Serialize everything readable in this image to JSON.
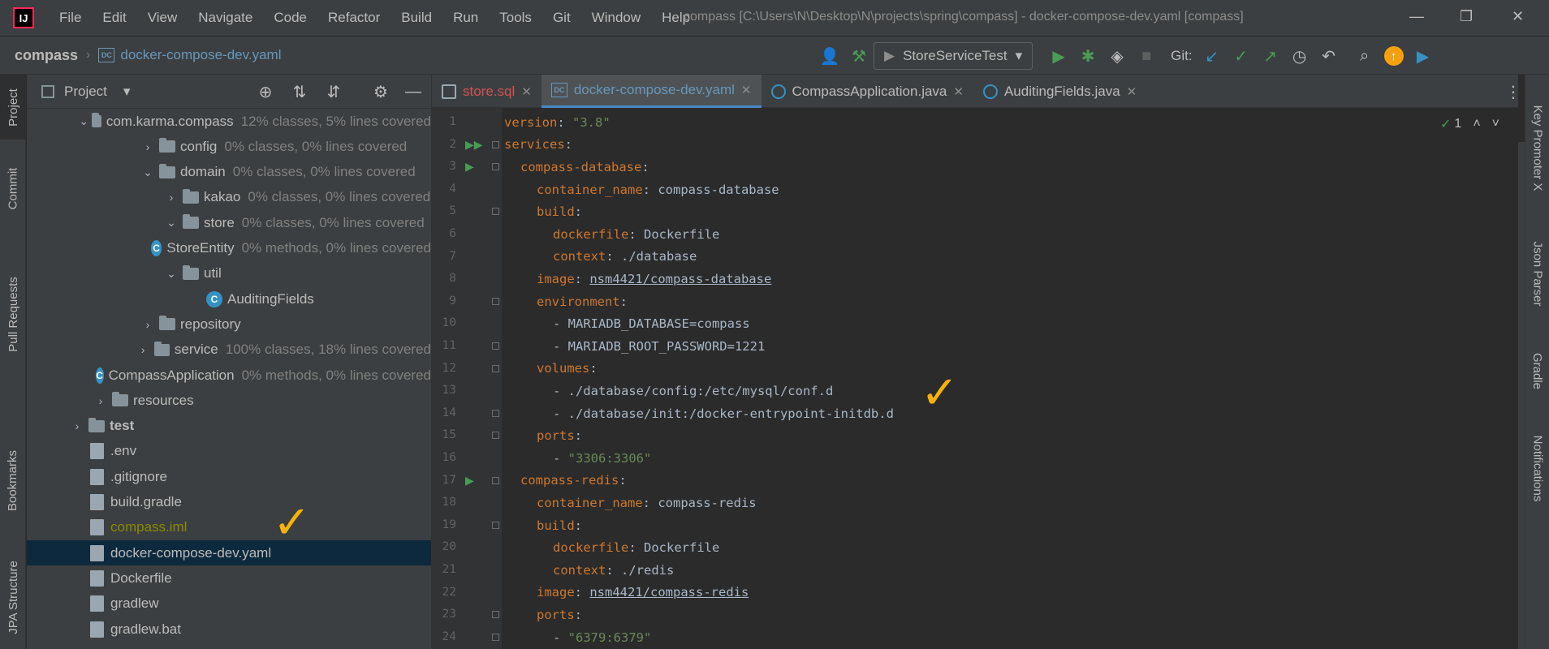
{
  "menubar": {
    "logo": "IJ",
    "items": [
      "File",
      "Edit",
      "View",
      "Navigate",
      "Code",
      "Refactor",
      "Build",
      "Run",
      "Tools",
      "Git",
      "Window",
      "Help"
    ],
    "window_title": "compass [C:\\Users\\N\\Desktop\\N\\projects\\spring\\compass] - docker-compose-dev.yaml [compass]"
  },
  "navbar": {
    "project": "compass",
    "file": "docker-compose-dev.yaml",
    "file_icon": "DC",
    "run_config": "StoreServiceTest",
    "git_label": "Git:"
  },
  "left_stripe": {
    "tabs": [
      "Project",
      "Commit",
      "Pull Requests",
      "Bookmarks",
      "JPA Structure"
    ]
  },
  "project_panel": {
    "title": "Project",
    "tree": [
      {
        "name": "com.karma.compass",
        "hint": "12% classes, 5% lines covered",
        "kind": "folder",
        "chevron": "down",
        "indent": 1
      },
      {
        "name": "config",
        "hint": "0% classes, 0% lines covered",
        "kind": "folder",
        "chevron": "right",
        "indent": 2
      },
      {
        "name": "domain",
        "hint": "0% classes, 0% lines covered",
        "kind": "folder",
        "chevron": "down",
        "indent": 2
      },
      {
        "name": "kakao",
        "hint": "0% classes, 0% lines covered",
        "kind": "folder",
        "chevron": "right",
        "indent": 3
      },
      {
        "name": "store",
        "hint": "0% classes, 0% lines covered",
        "kind": "folder",
        "chevron": "down",
        "indent": 3
      },
      {
        "name": "StoreEntity",
        "hint": "0% methods, 0% lines covered",
        "kind": "class",
        "chevron": "",
        "indent": 4
      },
      {
        "name": "util",
        "hint": "",
        "kind": "folder",
        "chevron": "down",
        "indent": 3
      },
      {
        "name": "AuditingFields",
        "hint": "",
        "kind": "class",
        "chevron": "",
        "indent": 4
      },
      {
        "name": "repository",
        "hint": "",
        "kind": "folder",
        "chevron": "right",
        "indent": 2
      },
      {
        "name": "service",
        "hint": "100% classes, 18% lines covered",
        "kind": "folder",
        "chevron": "right",
        "indent": 2
      },
      {
        "name": "CompassApplication",
        "hint": "0% methods, 0% lines covered",
        "kind": "class",
        "chevron": "",
        "indent": 2
      },
      {
        "name": "resources",
        "hint": "",
        "kind": "folder",
        "chevron": "right",
        "indent": 0
      },
      {
        "name": "test",
        "hint": "",
        "kind": "folder-bold",
        "chevron": "right",
        "indent": -1
      },
      {
        "name": ".env",
        "hint": "",
        "kind": "file",
        "chevron": "",
        "indent": -1
      },
      {
        "name": ".gitignore",
        "hint": "",
        "kind": "file",
        "chevron": "",
        "indent": -1
      },
      {
        "name": "build.gradle",
        "hint": "",
        "kind": "file",
        "chevron": "",
        "indent": -1
      },
      {
        "name": "compass.iml",
        "hint": "",
        "kind": "file-ignored",
        "chevron": "",
        "indent": -1
      },
      {
        "name": "docker-compose-dev.yaml",
        "hint": "",
        "kind": "file-selected",
        "chevron": "",
        "indent": -1
      },
      {
        "name": "Dockerfile",
        "hint": "",
        "kind": "file",
        "chevron": "",
        "indent": -1
      },
      {
        "name": "gradlew",
        "hint": "",
        "kind": "file",
        "chevron": "",
        "indent": -1
      },
      {
        "name": "gradlew.bat",
        "hint": "",
        "kind": "file",
        "chevron": "",
        "indent": -1
      }
    ]
  },
  "tabs": [
    {
      "label": "store.sql",
      "style": "sql",
      "active": false
    },
    {
      "label": "docker-compose-dev.yaml",
      "style": "yaml",
      "active": true
    },
    {
      "label": "CompassApplication.java",
      "style": "java",
      "active": false
    },
    {
      "label": "AuditingFields.java",
      "style": "java",
      "active": false
    }
  ],
  "inspection": {
    "count": "1"
  },
  "code": [
    {
      "n": "1",
      "indent": 0,
      "tokens": [
        [
          "key",
          "version"
        ],
        [
          "val",
          ": "
        ],
        [
          "str",
          "\"3.8\""
        ]
      ]
    },
    {
      "n": "2",
      "indent": 0,
      "tokens": [
        [
          "key",
          "services"
        ],
        [
          "val",
          ":"
        ]
      ]
    },
    {
      "n": "3",
      "indent": 1,
      "tokens": [
        [
          "key",
          "compass-database"
        ],
        [
          "val",
          ":"
        ]
      ]
    },
    {
      "n": "4",
      "indent": 2,
      "tokens": [
        [
          "key",
          "container_name"
        ],
        [
          "val",
          ": compass-database"
        ]
      ]
    },
    {
      "n": "5",
      "indent": 2,
      "tokens": [
        [
          "key",
          "build"
        ],
        [
          "val",
          ":"
        ]
      ]
    },
    {
      "n": "6",
      "indent": 3,
      "tokens": [
        [
          "key",
          "dockerfile"
        ],
        [
          "val",
          ": Dockerfile"
        ]
      ]
    },
    {
      "n": "7",
      "indent": 3,
      "tokens": [
        [
          "key",
          "context"
        ],
        [
          "val",
          ": ./database"
        ]
      ]
    },
    {
      "n": "8",
      "indent": 2,
      "tokens": [
        [
          "key",
          "image"
        ],
        [
          "val",
          ": "
        ],
        [
          "link",
          "nsm4421/compass-database"
        ]
      ]
    },
    {
      "n": "9",
      "indent": 2,
      "tokens": [
        [
          "key",
          "environment"
        ],
        [
          "val",
          ":"
        ]
      ]
    },
    {
      "n": "10",
      "indent": 3,
      "tokens": [
        [
          "val",
          "- MARIADB_DATABASE=compass"
        ]
      ]
    },
    {
      "n": "11",
      "indent": 3,
      "tokens": [
        [
          "val",
          "- MARIADB_ROOT_PASSWORD=1221"
        ]
      ]
    },
    {
      "n": "12",
      "indent": 2,
      "tokens": [
        [
          "key",
          "volumes"
        ],
        [
          "val",
          ":"
        ]
      ]
    },
    {
      "n": "13",
      "indent": 3,
      "tokens": [
        [
          "val",
          "- ./database/config:/etc/mysql/conf.d"
        ]
      ]
    },
    {
      "n": "14",
      "indent": 3,
      "tokens": [
        [
          "val",
          "- ./database/init:/docker-entrypoint-initdb.d"
        ]
      ]
    },
    {
      "n": "15",
      "indent": 2,
      "tokens": [
        [
          "key",
          "ports"
        ],
        [
          "val",
          ":"
        ]
      ]
    },
    {
      "n": "16",
      "indent": 3,
      "tokens": [
        [
          "val",
          "- "
        ],
        [
          "str",
          "\"3306:3306\""
        ]
      ]
    },
    {
      "n": "17",
      "indent": 1,
      "tokens": [
        [
          "key",
          "compass-redis"
        ],
        [
          "val",
          ":"
        ]
      ]
    },
    {
      "n": "18",
      "indent": 2,
      "tokens": [
        [
          "key",
          "container_name"
        ],
        [
          "val",
          ": compass-redis"
        ]
      ]
    },
    {
      "n": "19",
      "indent": 2,
      "tokens": [
        [
          "key",
          "build"
        ],
        [
          "val",
          ":"
        ]
      ]
    },
    {
      "n": "20",
      "indent": 3,
      "tokens": [
        [
          "key",
          "dockerfile"
        ],
        [
          "val",
          ": Dockerfile"
        ]
      ]
    },
    {
      "n": "21",
      "indent": 3,
      "tokens": [
        [
          "key",
          "context"
        ],
        [
          "val",
          ": ./redis"
        ]
      ]
    },
    {
      "n": "22",
      "indent": 2,
      "tokens": [
        [
          "key",
          "image"
        ],
        [
          "val",
          ": "
        ],
        [
          "link",
          "nsm4421/compass-redis"
        ]
      ]
    },
    {
      "n": "23",
      "indent": 2,
      "tokens": [
        [
          "key",
          "ports"
        ],
        [
          "val",
          ":"
        ]
      ]
    },
    {
      "n": "24",
      "indent": 3,
      "tokens": [
        [
          "val",
          "- "
        ],
        [
          "str",
          "\"6379:6379\""
        ]
      ]
    }
  ],
  "right_stripe": {
    "tabs": [
      "Key Promoter X",
      "Json Parser",
      "Gradle",
      "Notifications"
    ]
  },
  "annotations": {
    "checkmark": "✓"
  },
  "colors": {
    "accent": "#4a88c7",
    "checkmark": "#f6b10b",
    "key": "#cc7832",
    "string": "#6a8759"
  }
}
